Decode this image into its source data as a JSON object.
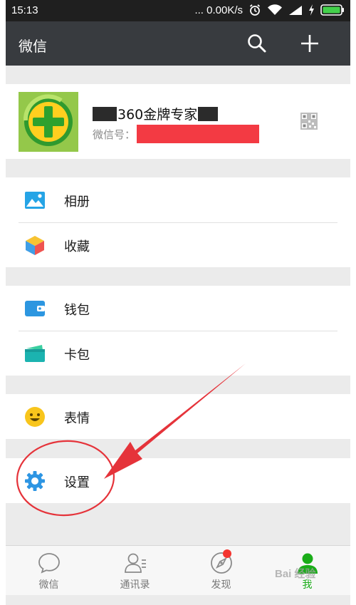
{
  "status_bar": {
    "time": "15:13",
    "speed": "... 0.00K/s"
  },
  "title_bar": {
    "title": "微信"
  },
  "profile": {
    "name": "360金牌专家",
    "id_label": "微信号："
  },
  "groups": [
    {
      "items": [
        {
          "label": "相册",
          "icon": "photo-album-icon"
        },
        {
          "label": "收藏",
          "icon": "favorites-cube-icon"
        }
      ]
    },
    {
      "items": [
        {
          "label": "钱包",
          "icon": "wallet-icon"
        },
        {
          "label": "卡包",
          "icon": "card-pack-icon"
        }
      ]
    },
    {
      "items": [
        {
          "label": "表情",
          "icon": "smiley-icon"
        }
      ]
    },
    {
      "items": [
        {
          "label": "设置",
          "icon": "gear-icon"
        }
      ]
    }
  ],
  "tabs": [
    {
      "label": "微信",
      "icon": "chat-bubble-icon"
    },
    {
      "label": "通讯录",
      "icon": "contacts-icon"
    },
    {
      "label": "发现",
      "icon": "compass-icon"
    },
    {
      "label": "我",
      "icon": "me-person-icon",
      "active": true
    }
  ],
  "watermark": "Bai 经验",
  "colors": {
    "title_bar": "#383b3f",
    "active_tab": "#1aad19",
    "annotation": "#e5333a",
    "redaction": "#f33a43"
  }
}
